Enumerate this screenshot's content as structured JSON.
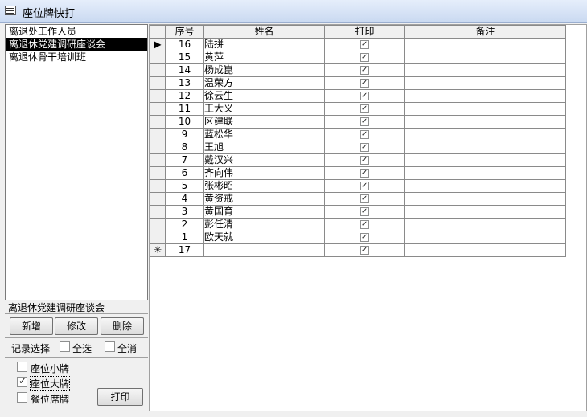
{
  "window": {
    "title": "座位牌快打"
  },
  "left": {
    "groups": [
      "离退处工作人员",
      "离退休党建调研座谈会",
      "离退休骨干培训班"
    ],
    "selected_index": 1,
    "selected_group_label": "离退休党建调研座谈会",
    "buttons": {
      "add": "新增",
      "edit": "修改",
      "delete": "删除"
    },
    "record_select": {
      "label": "记录选择",
      "select_all": "全选",
      "clear_all": "全消"
    },
    "print_options": [
      {
        "label": "座位小牌",
        "checked": false
      },
      {
        "label": "座位大牌",
        "checked": true
      },
      {
        "label": "餐位席牌",
        "checked": false
      }
    ],
    "print_button": "打印"
  },
  "grid": {
    "columns": [
      "序号",
      "姓名",
      "打印",
      "备注"
    ],
    "rows": [
      {
        "no": "16",
        "name": "陆拼",
        "print": true,
        "note": ""
      },
      {
        "no": "15",
        "name": "黄萍",
        "print": true,
        "note": ""
      },
      {
        "no": "14",
        "name": "杨成崑",
        "print": true,
        "note": ""
      },
      {
        "no": "13",
        "name": "温荣方",
        "print": true,
        "note": ""
      },
      {
        "no": "12",
        "name": "徐云生",
        "print": true,
        "note": ""
      },
      {
        "no": "11",
        "name": "王大义",
        "print": true,
        "note": ""
      },
      {
        "no": "10",
        "name": "区建联",
        "print": true,
        "note": ""
      },
      {
        "no": "9",
        "name": "蓝松华",
        "print": true,
        "note": ""
      },
      {
        "no": "8",
        "name": "王旭",
        "print": true,
        "note": ""
      },
      {
        "no": "7",
        "name": "戴汉兴",
        "print": true,
        "note": ""
      },
      {
        "no": "6",
        "name": "齐向伟",
        "print": true,
        "note": ""
      },
      {
        "no": "5",
        "name": "张彬昭",
        "print": true,
        "note": ""
      },
      {
        "no": "4",
        "name": "黄资戒",
        "print": true,
        "note": ""
      },
      {
        "no": "3",
        "name": "黄国育",
        "print": true,
        "note": ""
      },
      {
        "no": "2",
        "name": "彭任清",
        "print": true,
        "note": ""
      },
      {
        "no": "1",
        "name": "欧天就",
        "print": true,
        "note": ""
      }
    ],
    "new_row": {
      "no": "17",
      "print": true
    },
    "current_marker": "▶",
    "new_marker": "✳"
  }
}
